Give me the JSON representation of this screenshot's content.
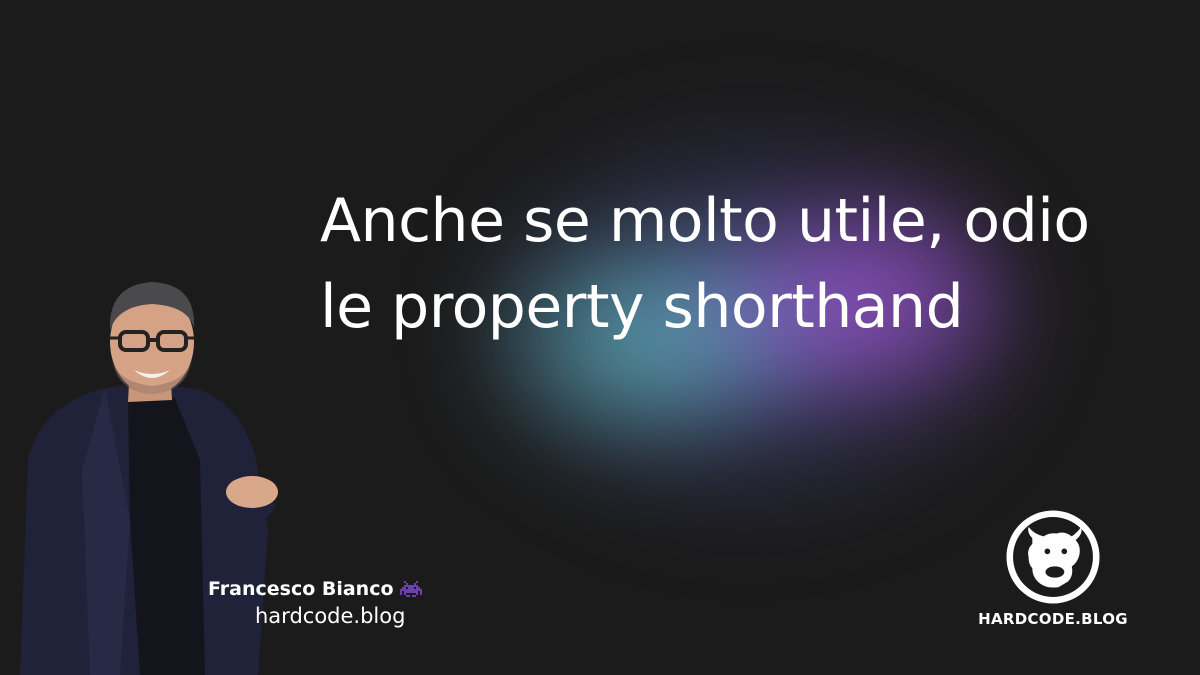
{
  "headline": {
    "line1": "Anche se molto utile, odio",
    "line2": "le property shorthand"
  },
  "author": {
    "name": "Francesco Bianco",
    "site": "hardcode.blog",
    "badge_icon": "alien-monster-icon"
  },
  "brand": {
    "name": "HARDCODE.BLOG",
    "logo_icon": "bull-head-icon"
  },
  "colors": {
    "background": "#1b1b1b",
    "text": "#ffffff",
    "glow_purple": "#9650c8",
    "glow_teal": "#5aaab4",
    "badge_purple": "#6a3fb0"
  }
}
